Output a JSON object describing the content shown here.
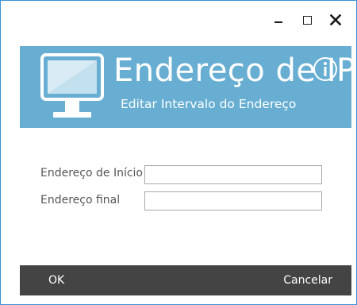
{
  "window": {
    "controls": {
      "minimize_icon": "minimize-icon",
      "maximize_icon": "maximize-icon",
      "close_icon": "close-icon"
    }
  },
  "banner": {
    "title": "Endereço de IP",
    "subtitle": "Editar Intervalo do Endereço",
    "icon": "monitor-icon",
    "info_icon": "info-icon",
    "background_color": "#67aed2"
  },
  "form": {
    "start_label": "Endereço de Início",
    "start_value": "",
    "end_label": "Endereço final",
    "end_value": ""
  },
  "footer": {
    "ok_label": "OK",
    "cancel_label": "Cancelar",
    "background_color": "#444444"
  }
}
